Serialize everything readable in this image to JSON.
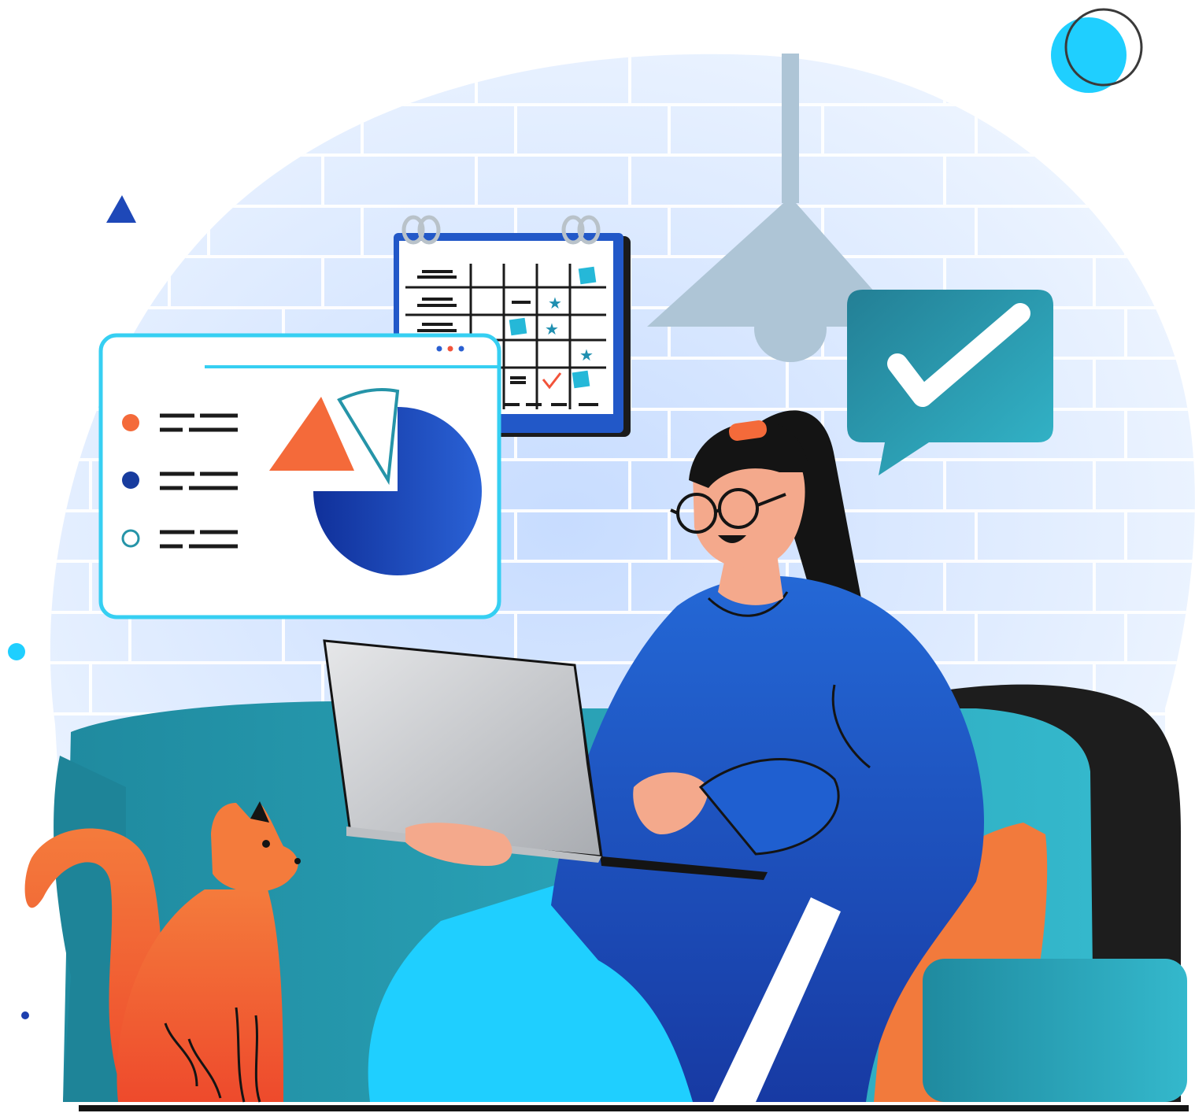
{
  "illustration": {
    "subject": "woman-working-on-laptop-on-sofa-with-cat",
    "elements": [
      "brick-wall-backdrop",
      "pendant-lamp-icon",
      "wall-calendar-icon",
      "pie-chart-dashboard-window",
      "checkmark-speech-bubble-icon",
      "woman-with-glasses",
      "laptop-icon",
      "sofa",
      "orange-cat",
      "decorative-shapes"
    ],
    "pie_chart_segments": {
      "orange_fraction": 0.125,
      "outline_fraction": 0.083,
      "blue_fraction": 0.75
    },
    "legend_items": [
      "orange-dot",
      "blue-dot",
      "outline-dot"
    ]
  },
  "colors": {
    "backdrop": "#e4efff",
    "brick_lines": "#ffffff",
    "lamp": "#aec5d6",
    "dashboard_border": "#36cff2",
    "orange": "#f46a3a",
    "navy": "#183c9e",
    "blue": "#1f5fd0",
    "teal": "#2594a8",
    "teal_light": "#2fb4c9",
    "sky": "#1fcfff",
    "skin": "#f4a98c",
    "hair": "#141414",
    "sofa_back": "#1d1d1d",
    "laptop": "#cdcfd2",
    "bubble": "#278ea2"
  }
}
